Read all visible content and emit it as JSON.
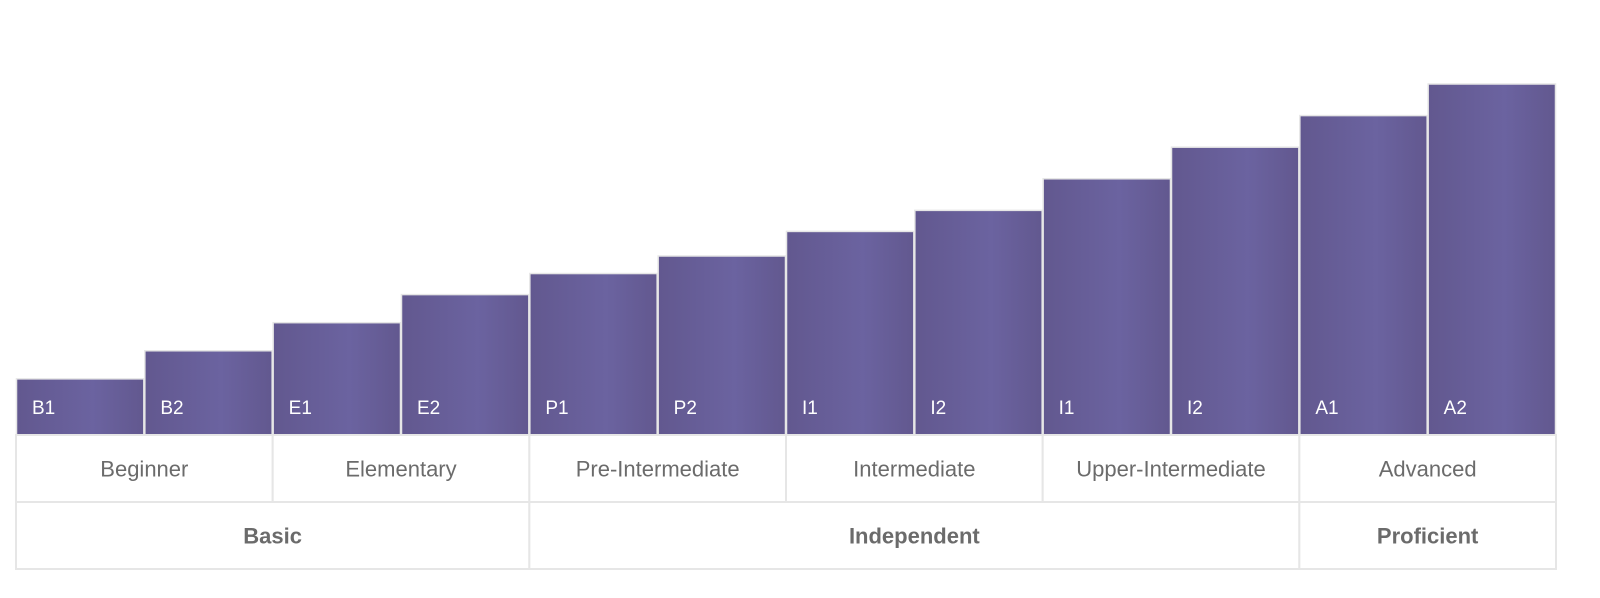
{
  "chart_data": {
    "type": "bar",
    "title": "",
    "xlabel": "",
    "ylabel": "",
    "grid": false,
    "legend": "none",
    "bar_color": "#62588f",
    "bar_color_end": "#6b63a0",
    "border_color": "#e6e6e6",
    "text_color": "#6b6b6b",
    "ylim": [
      0,
      100
    ],
    "categories": [
      "B1",
      "B2",
      "E1",
      "E2",
      "P1",
      "P2",
      "I1",
      "I2",
      "I1",
      "I2",
      "A1",
      "A2"
    ],
    "values": [
      16,
      24,
      32,
      40,
      46,
      51,
      58,
      64,
      73,
      82,
      91,
      100
    ],
    "levels": [
      {
        "label": "Beginner",
        "span": 2
      },
      {
        "label": "Elementary",
        "span": 2
      },
      {
        "label": "Pre-Intermediate",
        "span": 2
      },
      {
        "label": "Intermediate",
        "span": 2
      },
      {
        "label": "Upper-Intermediate",
        "span": 2
      },
      {
        "label": "Advanced",
        "span": 2
      }
    ],
    "groups": [
      {
        "label": "Basic",
        "span": 4
      },
      {
        "label": "Independent",
        "span": 6
      },
      {
        "label": "Proficient",
        "span": 2
      }
    ]
  }
}
